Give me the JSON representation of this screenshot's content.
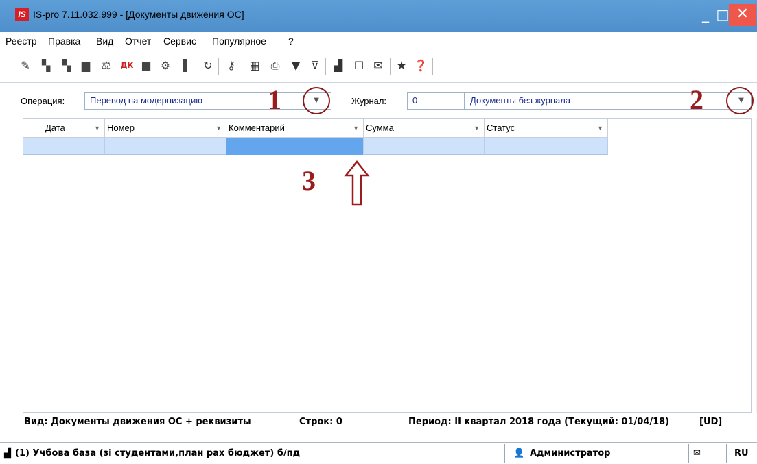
{
  "window": {
    "logo_text": "IS",
    "title": "IS-pro 7.11.032.999 - [Документы движения ОС]",
    "minimize": "_",
    "maximize": "□",
    "close": "✕"
  },
  "menu": {
    "items": [
      "Реестр",
      "Правка",
      "Вид",
      "Отчет",
      "Сервис",
      "Популярное",
      "?"
    ]
  },
  "toolbar": {
    "icons": [
      "new-doc-icon",
      "copy-doc-icon",
      "copy-doc-2-icon",
      "folder-icon",
      "balance-icon",
      "dk-posting-icon",
      "print-icon",
      "settings-box-icon",
      "group-icon",
      "refresh-icon",
      "key-icon",
      "table-icon",
      "report-icon",
      "filter-icon",
      "clear-filter-icon",
      "chart-icon",
      "form-icon",
      "mail-icon",
      "star-icon",
      "help-icon"
    ]
  },
  "filters": {
    "operation_label": "Операция:",
    "operation_value": "Перевод на модернизацию",
    "journal_label": "Журнал:",
    "journal_code": "0",
    "journal_value": "Документы без журнала"
  },
  "annotations": {
    "marker1": "1",
    "marker2": "2",
    "marker3": "3"
  },
  "grid": {
    "columns": [
      "Дата",
      "Номер",
      "Комментарий",
      "Сумма",
      "Статус"
    ],
    "rows": []
  },
  "info": {
    "view": "Вид: Документы движения ОС + реквизиты",
    "rows_count": "Строк: 0",
    "period": "Период: II квартал 2018 года (Текущий: 01/04/18)",
    "mode": "[UD]"
  },
  "status": {
    "database": "(1) Учбова база (зі студентами,план рах бюджет) б/пд",
    "user": "Администратор",
    "lang": "RU"
  },
  "colors": {
    "titlebar": "#5b9bd5",
    "close_button": "#f0574b",
    "row_highlight": "#cfe2fb",
    "cell_selected": "#63a6ee",
    "annotation": "#9b1c1c"
  }
}
